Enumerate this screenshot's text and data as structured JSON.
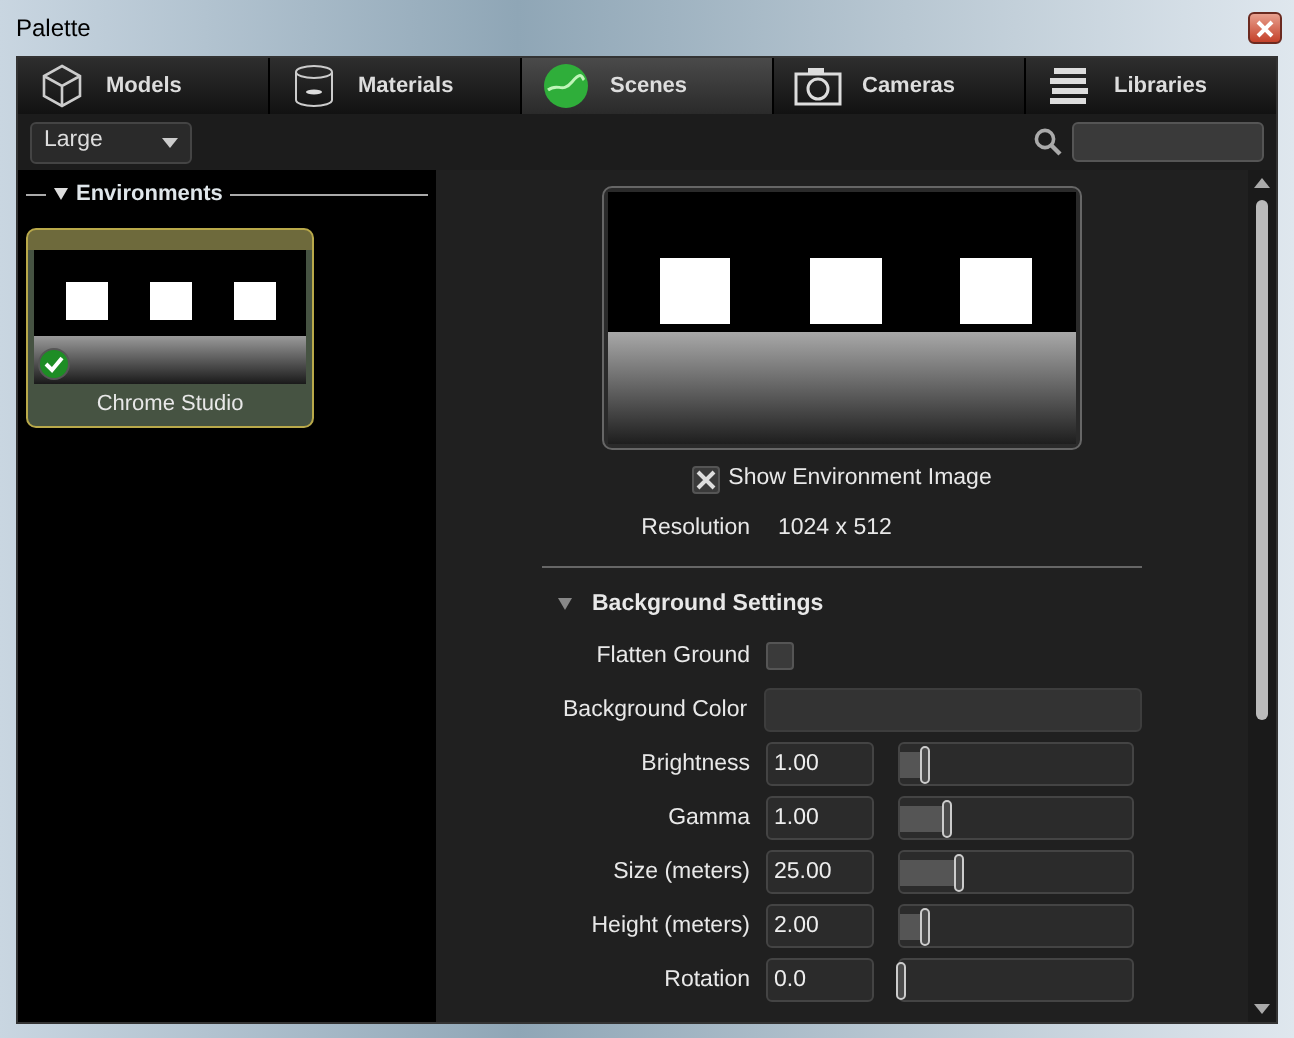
{
  "window": {
    "title": "Palette"
  },
  "tabs": [
    {
      "label": "Models",
      "selected": false
    },
    {
      "label": "Materials",
      "selected": false
    },
    {
      "label": "Scenes",
      "selected": true
    },
    {
      "label": "Cameras",
      "selected": false
    },
    {
      "label": "Libraries",
      "selected": false
    }
  ],
  "size_dropdown": {
    "value": "Large"
  },
  "sidebar": {
    "section": "Environments",
    "expanded": true,
    "items": [
      {
        "label": "Chrome Studio",
        "selected": true,
        "in_use": true
      }
    ]
  },
  "preview": {
    "show_image": {
      "label": "Show Environment Image",
      "checked": true
    },
    "resolution": {
      "label": "Resolution",
      "value": "1024 x 512"
    }
  },
  "background_settings": {
    "title": "Background Settings",
    "expanded": true,
    "rows": [
      {
        "kind": "checkbox",
        "label": "Flatten Ground",
        "checked": false
      },
      {
        "kind": "color",
        "label": "Background Color"
      },
      {
        "kind": "slider",
        "label": "Brightness",
        "value": "1.00",
        "level": 0.1
      },
      {
        "kind": "slider",
        "label": "Gamma",
        "value": "1.00",
        "level": 0.2
      },
      {
        "kind": "slider",
        "label": "Size (meters)",
        "value": "25.00",
        "level": 0.25
      },
      {
        "kind": "slider",
        "label": "Height (meters)",
        "value": "2.00",
        "level": 0.1
      },
      {
        "kind": "slider",
        "label": "Rotation",
        "value": "0.0",
        "level": 0
      }
    ]
  }
}
